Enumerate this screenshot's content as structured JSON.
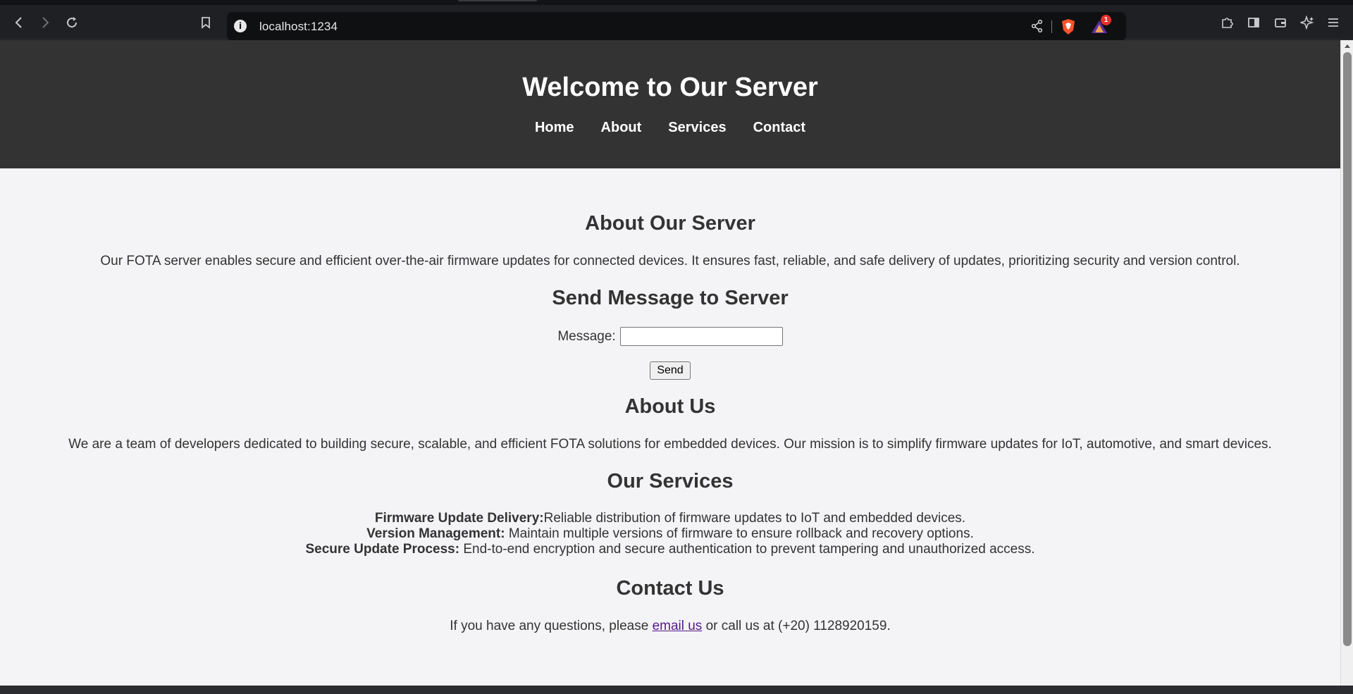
{
  "browser": {
    "url": "localhost:1234",
    "notification_count": "1"
  },
  "header": {
    "title": "Welcome to Our Server",
    "nav": [
      {
        "label": "Home"
      },
      {
        "label": "About"
      },
      {
        "label": "Services"
      },
      {
        "label": "Contact"
      }
    ]
  },
  "about_server": {
    "heading": "About Our Server",
    "text": "Our FOTA server enables secure and efficient over-the-air firmware updates for connected devices. It ensures fast, reliable, and safe delivery of updates, prioritizing security and version control."
  },
  "send_message": {
    "heading": "Send Message to Server",
    "label": "Message:",
    "value": "",
    "button": "Send"
  },
  "about_us": {
    "heading": "About Us",
    "text": "We are a team of developers dedicated to building secure, scalable, and efficient FOTA solutions for embedded devices. Our mission is to simplify firmware updates for IoT, automotive, and smart devices."
  },
  "services": {
    "heading": "Our Services",
    "items": [
      {
        "title": "Firmware Update Delivery:",
        "text": "Reliable distribution of firmware updates to IoT and embedded devices."
      },
      {
        "title": "Version Management:",
        "text": " Maintain multiple versions of firmware to ensure rollback and recovery options."
      },
      {
        "title": "Secure Update Process:",
        "text": " End-to-end encryption and secure authentication to prevent tampering and unauthorized access."
      }
    ]
  },
  "contact": {
    "heading": "Contact Us",
    "text_before": "If you have any questions, please ",
    "link": "email us",
    "text_after": " or call us at (+20) 1128920159."
  },
  "colors": {
    "header_bg": "#333333",
    "page_bg": "#f4f4f6",
    "text": "#333333",
    "visited_link": "#551a8b"
  }
}
